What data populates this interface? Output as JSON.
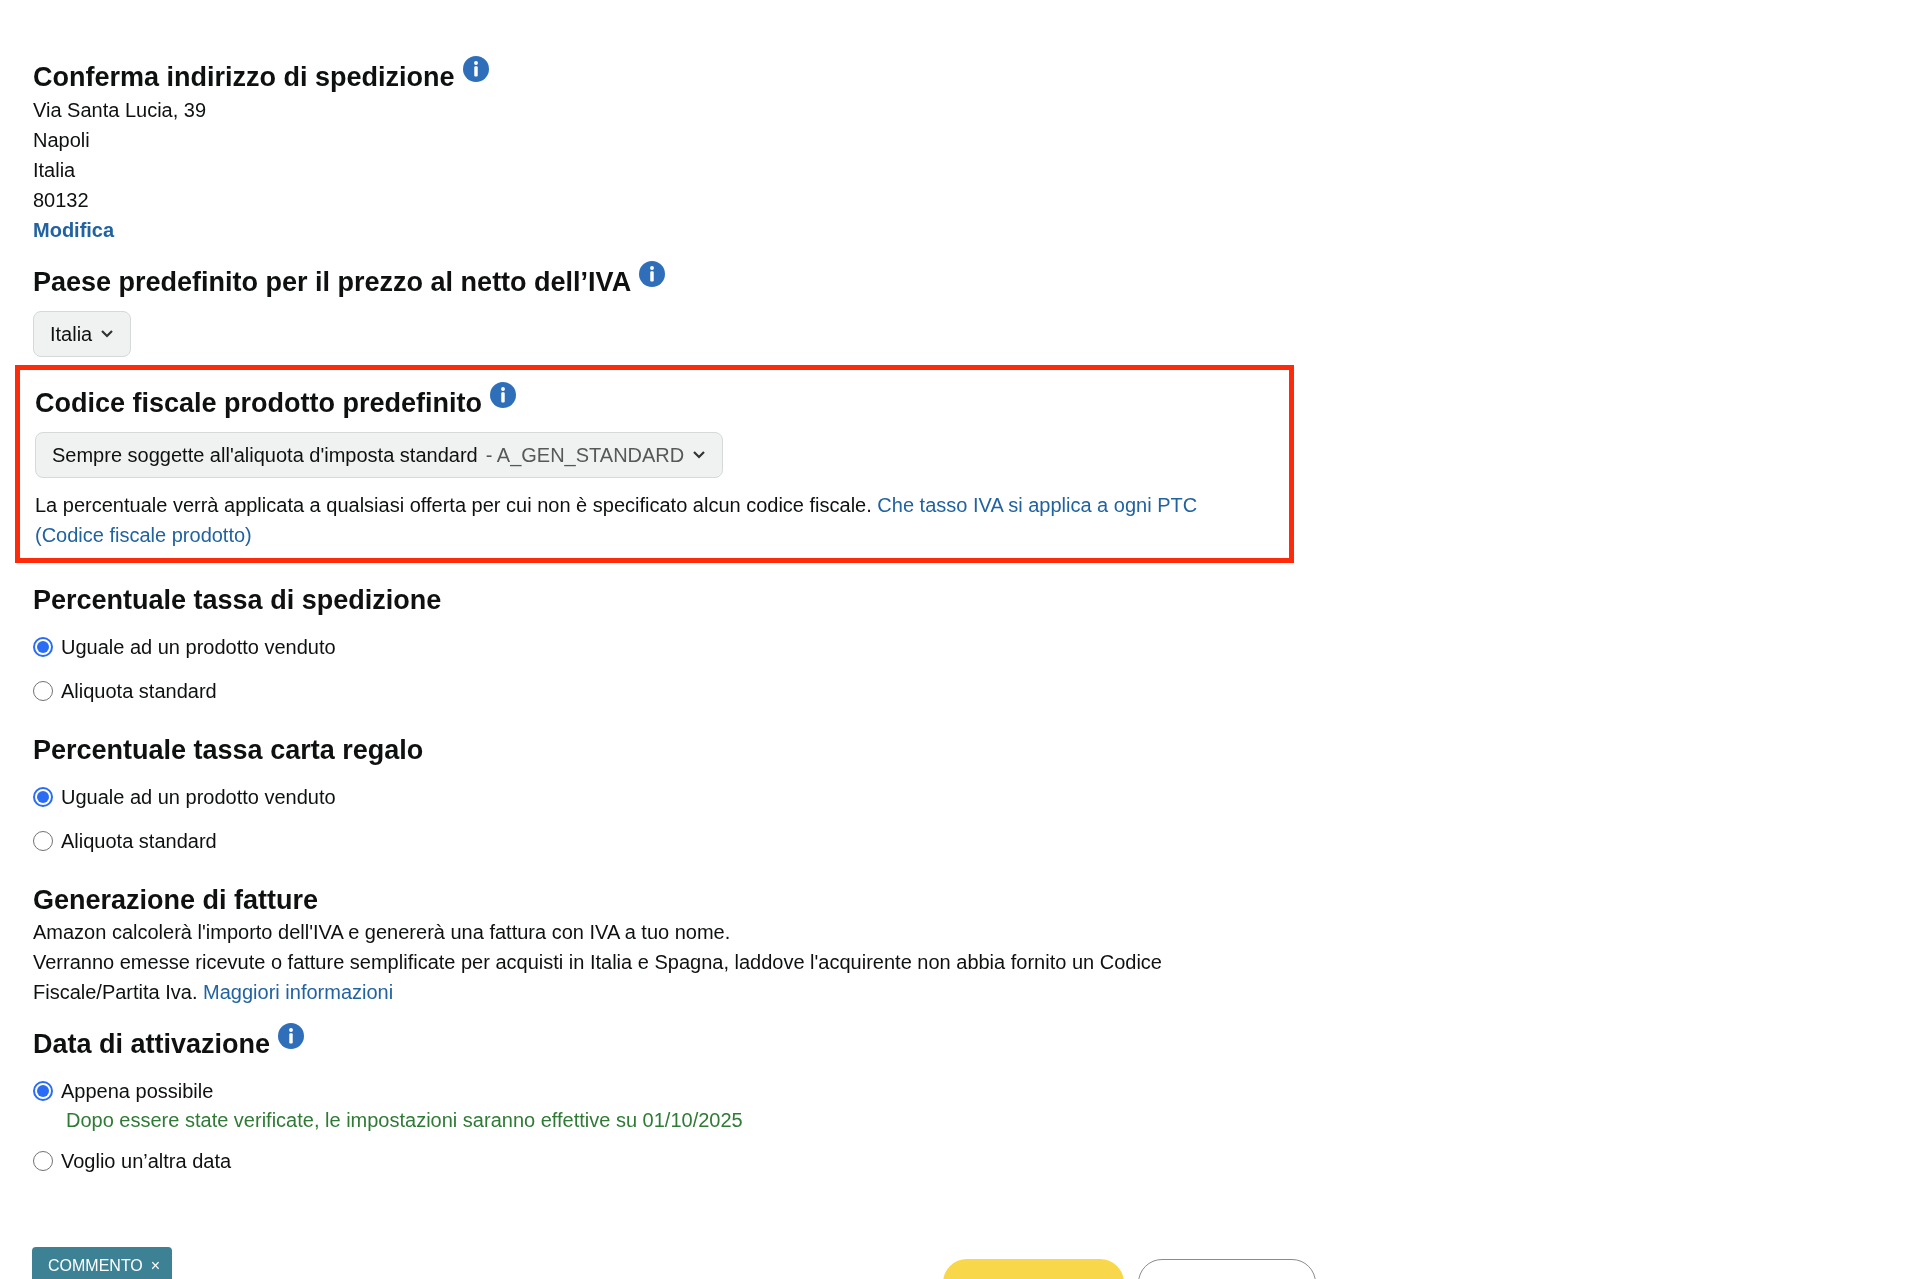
{
  "sections": [
    {
      "kind": "address",
      "title": "Conferma indirizzo di spedizione",
      "info": true,
      "highlighted": false,
      "lines": [
        "Via Santa Lucia, 39",
        "Napoli",
        "Italia",
        "80132"
      ],
      "link": "Modifica"
    },
    {
      "kind": "select",
      "title": "Paese predefinito per il prezzo al netto dell’IVA",
      "info": true,
      "highlighted": false,
      "value": "Italia"
    },
    {
      "kind": "select",
      "title": "Codice fiscale prodotto predefinito",
      "info": true,
      "highlighted": true,
      "value": "Sempre soggette all'aliquota d'imposta standard",
      "suffix": "- A_GEN_STANDARD",
      "note": "La percentuale verrà applicata a qualsiasi offerta per cui non è specificato alcun codice fiscale.",
      "note_link": [
        "Che tasso IVA si applica a ogni PTC",
        "(Codice fiscale prodotto)"
      ]
    },
    {
      "kind": "radio",
      "title": "Percentuale tassa di spedizione",
      "info": false,
      "highlighted": false,
      "options": [
        {
          "label": "Uguale ad un prodotto venduto",
          "selected": true
        },
        {
          "label": "Aliquota standard",
          "selected": false
        }
      ]
    },
    {
      "kind": "radio",
      "title": "Percentuale tassa carta regalo",
      "info": false,
      "highlighted": false,
      "options": [
        {
          "label": "Uguale ad un prodotto venduto",
          "selected": true
        },
        {
          "label": "Aliquota standard",
          "selected": false
        }
      ]
    },
    {
      "kind": "text",
      "title": "Generazione di fatture",
      "info": false,
      "highlighted": false,
      "paragraphs": [
        "Amazon calcolerà l'importo dell'IVA e genererà una fattura con IVA a tuo nome.",
        "Verranno emesse ricevute o fatture semplificate per acquisti in Italia e Spagna, laddove l'acquirente non abbia fornito un Codice Fiscale/Partita Iva."
      ],
      "link": "Maggiori informazioni"
    },
    {
      "kind": "radio",
      "title": "Data di attivazione",
      "info": true,
      "highlighted": false,
      "options": [
        {
          "label": "Appena possibile",
          "selected": true,
          "hint": "Dopo essere state verificate, le impostazioni saranno effettive su 01/10/2025"
        },
        {
          "label": "Voglio un’altra data",
          "selected": false
        }
      ]
    }
  ],
  "comment_tag": {
    "label": "COMMENTO",
    "close": "×"
  },
  "footer_buttons": [
    {
      "kind": "primary"
    },
    {
      "kind": "secondary"
    }
  ]
}
